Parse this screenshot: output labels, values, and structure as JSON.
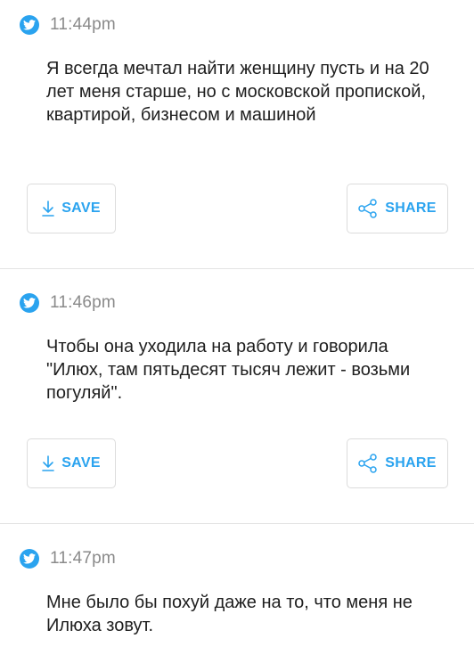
{
  "tweets": [
    {
      "time": "11:44pm",
      "text": "Я всегда мечтал найти женщину пусть и на 20 лет меня старше, но с московской пропиской,  квартирой,  бизнесом и машиной",
      "save_label": "SAVE",
      "share_label": "SHARE"
    },
    {
      "time": "11:46pm",
      "text": "Чтобы она уходила на работу и говорила \"Илюх, там пятьдесят тысяч лежит - возьми погуляй\".",
      "save_label": "SAVE",
      "share_label": "SHARE"
    },
    {
      "time": "11:47pm",
      "text": "Мне было бы похуй даже на то,  что меня не Илюха зовут."
    }
  ],
  "colors": {
    "accent": "#2aa3ef",
    "top_bar": "#f2603f",
    "text": "#1e1e1e",
    "muted": "#8a8a8a"
  },
  "icons": {
    "bird": "twitter-bird-icon",
    "save": "download-arrow-icon",
    "share": "share-nodes-icon"
  }
}
